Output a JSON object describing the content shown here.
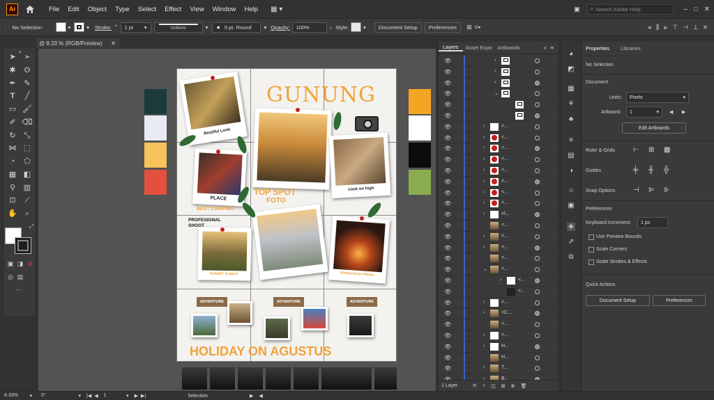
{
  "app": {
    "logo_text": "Ai",
    "menus": [
      "File",
      "Edit",
      "Object",
      "Type",
      "Select",
      "Effect",
      "View",
      "Window",
      "Help"
    ],
    "search_placeholder": "Search Adobe Help"
  },
  "control_bar": {
    "selection": "No Selection",
    "stroke_label": "Stroke:",
    "stroke_value": "1 pt",
    "uniform": "Uniform",
    "brush": "5 pt. Round",
    "opacity_label": "Opacity:",
    "opacity_value": "100%",
    "style_label": "Style:",
    "doc_setup": "Document Setup",
    "preferences": "Preferences"
  },
  "doc_tab": "@ 8.33 % (RGB/Preview)",
  "artboard": {
    "title": "GUNUNG",
    "labels": {
      "beautiful": "Beutiful Look",
      "place": "PLACE",
      "best_camping": "BEST CAMPING",
      "top_spot": "TOP SPOT",
      "foto": "FOTO",
      "cook": "cook on high",
      "profesional": "PROFESIONAL",
      "shoot": "SHOOT",
      "sunset": "SUNSET IS BEST",
      "mengintip": "Mengintipnya Malam",
      "adventure": "ADVENTURE",
      "holiday": "HOLIDAY ON AGUSTUS"
    },
    "left_colors": [
      "#1b3a3c",
      "#e9ebf3",
      "#f6c35a",
      "#e4503f"
    ],
    "right_colors": [
      "#f5a522",
      "#ffffff",
      "#0b0b0b",
      "#8aac4e"
    ]
  },
  "layers_panel": {
    "tabs": [
      "Layers",
      "Asset Expo",
      "Artboards"
    ],
    "row_labels": [
      "<...",
      "<...",
      "<...",
      "<...",
      "<...",
      "<...",
      "<...",
      "<...",
      "<l...",
      "<...",
      "<...",
      "<...",
      "<...",
      "<...",
      "<...",
      "<...",
      "<...",
      "<C...",
      "<...",
      "<...",
      "H...",
      "H...",
      "T...",
      "B..."
    ],
    "footer": "1 Layer"
  },
  "properties": {
    "tabs": [
      "Properties",
      "Libraries"
    ],
    "no_selection": "No Selection",
    "document": "Document",
    "units_label": "Units:",
    "units_value": "Pixels",
    "artboard_label": "Artboard:",
    "artboard_value": "1",
    "edit_artboards": "Edit Artboards",
    "rulers_grids": "Ruler & Grids",
    "guides": "Guides",
    "snap_options": "Snap Options",
    "preferences_title": "Preferences",
    "keyboard_increment_label": "Keyboard Increment:",
    "keyboard_increment_value": "1 px",
    "use_preview_bounds": "Use Preview Bounds",
    "scale_corners": "Scale Corners",
    "scale_strokes": "Scale Strokes & Effects",
    "quick_actions": "Quick Actions",
    "doc_setup": "Document Setup",
    "preferences": "Preferences"
  },
  "status": {
    "zoom": "8.33%",
    "rotate": "0°",
    "artboard_num": "1",
    "mode": "Selection"
  }
}
